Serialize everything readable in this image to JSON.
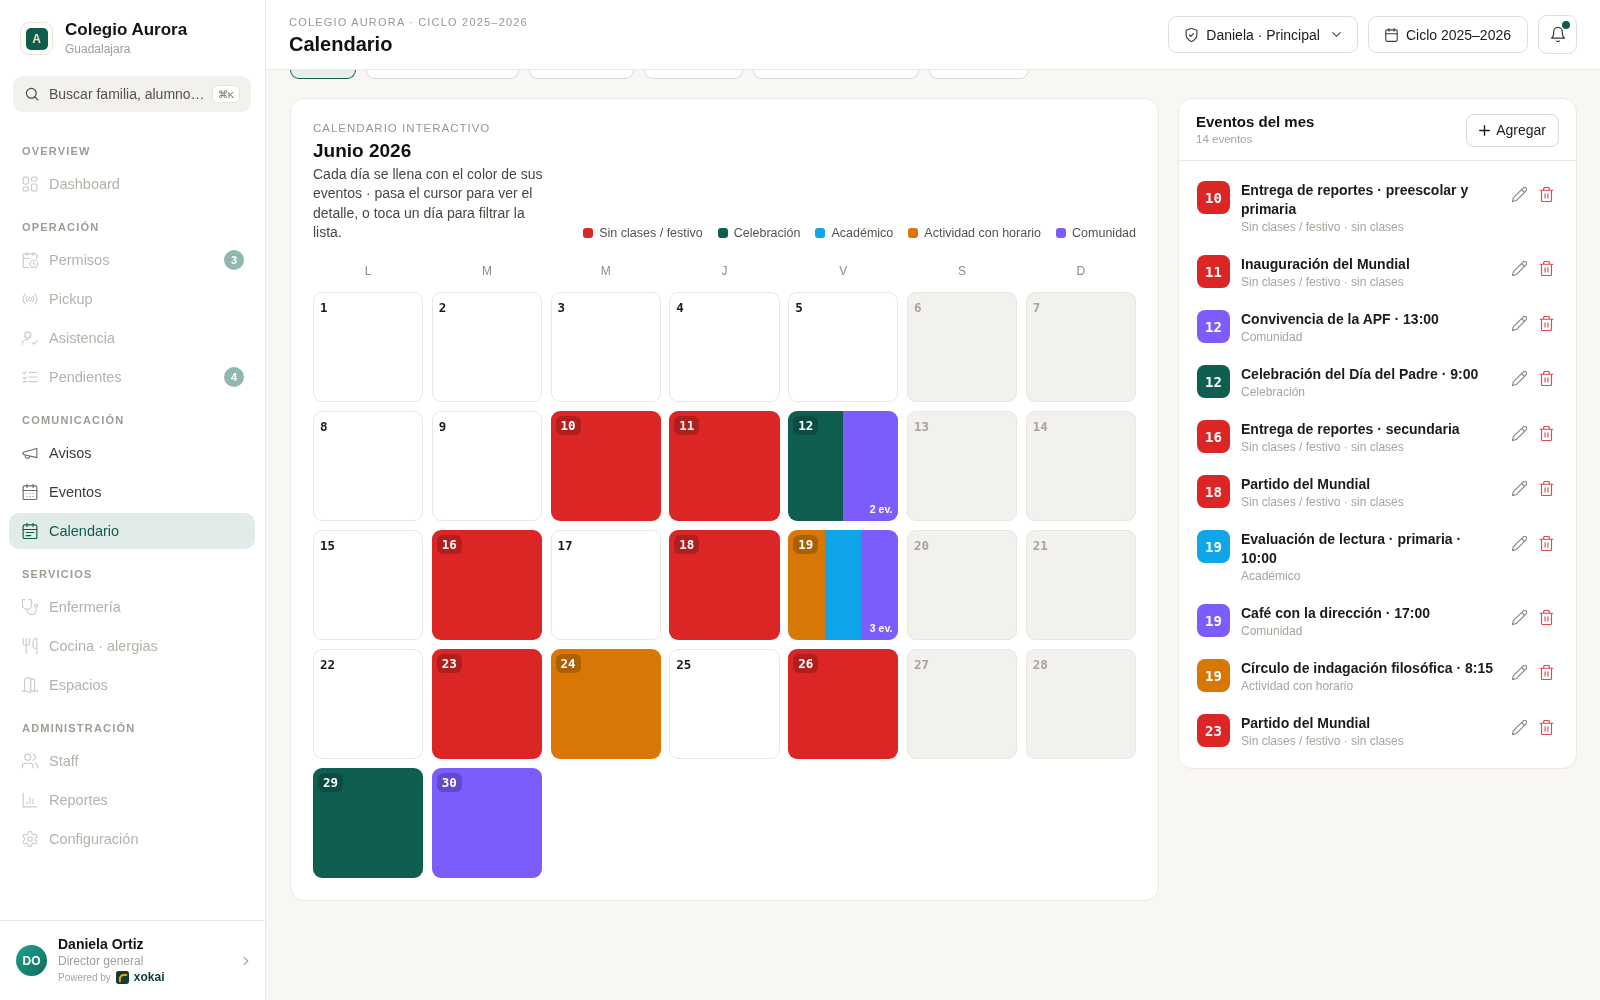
{
  "sidebar": {
    "brand": {
      "initial": "A",
      "name": "Colegio Aurora",
      "city": "Guadalajara"
    },
    "search": {
      "placeholder": "Buscar familia, alumno…",
      "shortcut": "⌘K"
    },
    "sections": [
      {
        "label": "OVERVIEW",
        "items": [
          {
            "label": "Dashboard",
            "disabled": true,
            "selected": false
          }
        ]
      },
      {
        "label": "OPERACIÓN",
        "items": [
          {
            "label": "Permisos",
            "disabled": true,
            "selected": false,
            "badge": "3"
          },
          {
            "label": "Pickup",
            "disabled": true,
            "selected": false
          },
          {
            "label": "Asistencia",
            "disabled": true,
            "selected": false
          },
          {
            "label": "Pendientes",
            "disabled": true,
            "selected": false,
            "badge": "4"
          }
        ]
      },
      {
        "label": "COMUNICACIÓN",
        "items": [
          {
            "label": "Avisos",
            "disabled": false,
            "selected": false
          },
          {
            "label": "Eventos",
            "disabled": false,
            "selected": false
          },
          {
            "label": "Calendario",
            "disabled": false,
            "selected": true
          }
        ]
      },
      {
        "label": "SERVICIOS",
        "items": [
          {
            "label": "Enfermería",
            "disabled": true,
            "selected": false
          },
          {
            "label": "Cocina · alergias",
            "disabled": true,
            "selected": false
          },
          {
            "label": "Espacios",
            "disabled": true,
            "selected": false
          }
        ]
      },
      {
        "label": "ADMINISTRACIÓN",
        "items": [
          {
            "label": "Staff",
            "disabled": true,
            "selected": false
          },
          {
            "label": "Reportes",
            "disabled": true,
            "selected": false
          },
          {
            "label": "Configuración",
            "disabled": true,
            "selected": false
          }
        ]
      }
    ],
    "user": {
      "initials": "DO",
      "name": "Daniela Ortiz",
      "role": "Director general",
      "powered_by": "Powered by",
      "brand": "xokai"
    }
  },
  "header": {
    "breadcrumb": "COLEGIO AURORA · CICLO 2025–2026",
    "title": "Calendario",
    "role_menu": "Daniela · Principal",
    "cycle_button": "Ciclo 2025–2026",
    "notifications": {
      "unread": true
    }
  },
  "filter_chips": [
    {
      "selected": true
    },
    {
      "selected": false
    },
    {
      "selected": false
    },
    {
      "selected": false
    },
    {
      "selected": false
    },
    {
      "selected": false
    }
  ],
  "calendar": {
    "eyebrow": "CALENDARIO INTERACTIVO",
    "month": "Junio 2026",
    "description": "Cada día se llena con el color de sus eventos · pasa el cursor para ver el detalle, o toca un día para filtrar la lista.",
    "legend": [
      {
        "label": "Sin clases / festivo",
        "color": "#dc2626"
      },
      {
        "label": "Celebración",
        "color": "#0e5e52"
      },
      {
        "label": "Académico",
        "color": "#0ea5e9"
      },
      {
        "label": "Actividad con horario",
        "color": "#d97706"
      },
      {
        "label": "Comunidad",
        "color": "#7c5cfc"
      }
    ],
    "weekdays": [
      "L",
      "M",
      "M",
      "J",
      "V",
      "S",
      "D"
    ],
    "days": [
      {
        "label": "1",
        "weekend": false
      },
      {
        "label": "2",
        "weekend": false
      },
      {
        "label": "3",
        "weekend": false
      },
      {
        "label": "4",
        "weekend": false
      },
      {
        "label": "5",
        "weekend": false
      },
      {
        "label": "6",
        "weekend": true
      },
      {
        "label": "7",
        "weekend": true
      },
      {
        "label": "8",
        "weekend": false
      },
      {
        "label": "9",
        "weekend": false
      },
      {
        "label": "10",
        "weekend": false,
        "stripes": [
          {
            "color": "#dc2626"
          }
        ]
      },
      {
        "label": "11",
        "weekend": false,
        "stripes": [
          {
            "color": "#dc2626"
          }
        ]
      },
      {
        "label": "12",
        "weekend": false,
        "stripes": [
          {
            "color": "#0e5e52"
          },
          {
            "color": "#7c5cfc"
          }
        ],
        "more": "2 ev."
      },
      {
        "label": "13",
        "weekend": true
      },
      {
        "label": "14",
        "weekend": true
      },
      {
        "label": "15",
        "weekend": false
      },
      {
        "label": "16",
        "weekend": false,
        "stripes": [
          {
            "color": "#dc2626"
          }
        ]
      },
      {
        "label": "17",
        "weekend": false
      },
      {
        "label": "18",
        "weekend": false,
        "stripes": [
          {
            "color": "#dc2626"
          }
        ]
      },
      {
        "label": "19",
        "weekend": false,
        "stripes": [
          {
            "color": "#d97706"
          },
          {
            "color": "#0ea5e9"
          },
          {
            "color": "#7c5cfc"
          }
        ],
        "more": "3 ev."
      },
      {
        "label": "20",
        "weekend": true
      },
      {
        "label": "21",
        "weekend": true
      },
      {
        "label": "22",
        "weekend": false
      },
      {
        "label": "23",
        "weekend": false,
        "stripes": [
          {
            "color": "#dc2626"
          }
        ]
      },
      {
        "label": "24",
        "weekend": false,
        "stripes": [
          {
            "color": "#d97706"
          }
        ]
      },
      {
        "label": "25",
        "weekend": false
      },
      {
        "label": "26",
        "weekend": false,
        "stripes": [
          {
            "color": "#dc2626"
          }
        ]
      },
      {
        "label": "27",
        "weekend": true
      },
      {
        "label": "28",
        "weekend": true
      },
      {
        "label": "29",
        "weekend": false,
        "stripes": [
          {
            "color": "#0e5e52"
          }
        ]
      },
      {
        "label": "30",
        "weekend": false,
        "stripes": [
          {
            "color": "#7c5cfc"
          }
        ]
      }
    ]
  },
  "events_panel": {
    "title": "Eventos del mes",
    "count": "14 eventos",
    "add_button": "Agregar",
    "events": [
      {
        "day": "10",
        "color": "#dc2626",
        "title": "Entrega de reportes · preescolar y primaria",
        "subtitle": "Sin clases / festivo · sin clases"
      },
      {
        "day": "11",
        "color": "#dc2626",
        "title": "Inauguración del Mundial",
        "subtitle": "Sin clases / festivo · sin clases"
      },
      {
        "day": "12",
        "color": "#7c5cfc",
        "title": "Convivencia de la APF · 13:00",
        "subtitle": "Comunidad"
      },
      {
        "day": "12",
        "color": "#0e5e52",
        "title": "Celebración del Día del Padre · 9:00",
        "subtitle": "Celebración"
      },
      {
        "day": "16",
        "color": "#dc2626",
        "title": "Entrega de reportes · secundaria",
        "subtitle": "Sin clases / festivo · sin clases"
      },
      {
        "day": "18",
        "color": "#dc2626",
        "title": "Partido del Mundial",
        "subtitle": "Sin clases / festivo · sin clases"
      },
      {
        "day": "19",
        "color": "#0ea5e9",
        "title": "Evaluación de lectura · primaria · 10:00",
        "subtitle": "Académico"
      },
      {
        "day": "19",
        "color": "#7c5cfc",
        "title": "Café con la dirección · 17:00",
        "subtitle": "Comunidad"
      },
      {
        "day": "19",
        "color": "#d97706",
        "title": "Círculo de indagación filosófica · 8:15",
        "subtitle": "Actividad con horario"
      },
      {
        "day": "23",
        "color": "#dc2626",
        "title": "Partido del Mundial",
        "subtitle": "Sin clases / festivo · sin clases"
      }
    ]
  }
}
